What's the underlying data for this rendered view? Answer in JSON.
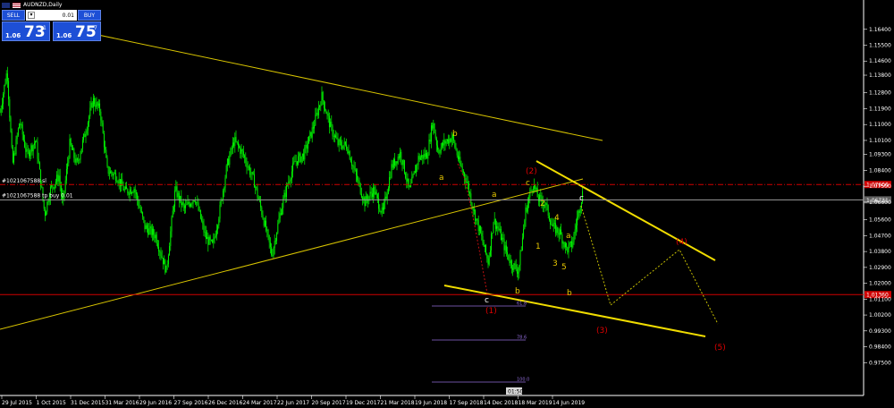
{
  "window": {
    "title": "AUDNZD,Daily"
  },
  "trade_panel": {
    "sell_label": "SELL",
    "buy_label": "BUY",
    "lot": "0.01",
    "sell_quote": {
      "small": "1.06",
      "big": "73",
      "sup": "1"
    },
    "buy_quote": {
      "small": "1.06",
      "big": "75",
      "sup": "7"
    }
  },
  "colors": {
    "background": "#000000",
    "candles": "#00ff00",
    "trendline": "#d8c400",
    "channel": "#f0dc00",
    "resistance": "#d00000",
    "support": "#d00000",
    "wave_major": "#e00000",
    "wave_minor": "#e8c800",
    "fib": "#8f6bd6"
  },
  "chart_data": {
    "type": "candlestick",
    "symbol": "AUDNZD",
    "timeframe": "Daily",
    "ylim": [
      0.965,
      1.172
    ],
    "y_ticks": [
      "1.16400",
      "1.15500",
      "1.14600",
      "1.13800",
      "1.12800",
      "1.11900",
      "1.11000",
      "1.10100",
      "1.09300",
      "1.08400",
      "1.07500",
      "1.06600",
      "1.05600",
      "1.04700",
      "1.03800",
      "1.02900",
      "1.02000",
      "1.01100",
      "1.00200",
      "0.99300",
      "0.98400",
      "0.97500"
    ],
    "x_ticks": [
      "29 Jul 2015",
      "1 Oct 2015",
      "31 Dec 2015",
      "31 Mar 2016",
      "29 Jun 2016",
      "27 Sep 2016",
      "26 Dec 2016",
      "24 Mar 2017",
      "22 Jun 2017",
      "20 Sep 2017",
      "19 Dec 2017",
      "21 Mar 2018",
      "19 Jun 2018",
      "17 Sep 2018",
      "14 Dec 2018",
      "18 Mar 2019",
      "14 Jun 2019"
    ],
    "price_path": [
      [
        0,
        1.117
      ],
      [
        8,
        1.141
      ],
      [
        14,
        1.087
      ],
      [
        22,
        1.112
      ],
      [
        30,
        1.093
      ],
      [
        40,
        1.101
      ],
      [
        50,
        1.059
      ],
      [
        56,
        1.073
      ],
      [
        66,
        1.081
      ],
      [
        70,
        1.064
      ],
      [
        78,
        1.099
      ],
      [
        86,
        1.087
      ],
      [
        96,
        1.107
      ],
      [
        104,
        1.124
      ],
      [
        112,
        1.118
      ],
      [
        120,
        1.084
      ],
      [
        130,
        1.081
      ],
      [
        140,
        1.072
      ],
      [
        150,
        1.074
      ],
      [
        162,
        1.052
      ],
      [
        174,
        1.047
      ],
      [
        186,
        1.027
      ],
      [
        196,
        1.073
      ],
      [
        206,
        1.062
      ],
      [
        218,
        1.069
      ],
      [
        230,
        1.046
      ],
      [
        238,
        1.041
      ],
      [
        246,
        1.062
      ],
      [
        254,
        1.087
      ],
      [
        262,
        1.101
      ],
      [
        272,
        1.093
      ],
      [
        284,
        1.078
      ],
      [
        294,
        1.058
      ],
      [
        304,
        1.036
      ],
      [
        314,
        1.061
      ],
      [
        322,
        1.077
      ],
      [
        330,
        1.089
      ],
      [
        340,
        1.093
      ],
      [
        350,
        1.108
      ],
      [
        360,
        1.126
      ],
      [
        370,
        1.108
      ],
      [
        378,
        1.099
      ],
      [
        388,
        1.098
      ],
      [
        398,
        1.081
      ],
      [
        408,
        1.066
      ],
      [
        418,
        1.073
      ],
      [
        428,
        1.059
      ],
      [
        438,
        1.086
      ],
      [
        448,
        1.094
      ],
      [
        458,
        1.072
      ],
      [
        468,
        1.091
      ],
      [
        478,
        1.093
      ],
      [
        484,
        1.112
      ],
      [
        490,
        1.095
      ],
      [
        498,
        1.1
      ],
      [
        506,
        1.103
      ],
      [
        514,
        1.088
      ],
      [
        522,
        1.078
      ],
      [
        530,
        1.061
      ],
      [
        538,
        1.047
      ],
      [
        546,
        1.032
      ],
      [
        552,
        1.056
      ],
      [
        558,
        1.05
      ],
      [
        566,
        1.038
      ],
      [
        572,
        1.031
      ],
      [
        580,
        1.027
      ],
      [
        588,
        1.061
      ],
      [
        596,
        1.077
      ],
      [
        602,
        1.068
      ],
      [
        610,
        1.065
      ],
      [
        618,
        1.052
      ],
      [
        626,
        1.049
      ],
      [
        634,
        1.039
      ],
      [
        640,
        1.042
      ],
      [
        646,
        1.058
      ],
      [
        652,
        1.072
      ]
    ],
    "current_price": "1.0673",
    "horizontal_levels": [
      {
        "name": "resistance-line",
        "price": 1.076,
        "style": "dash-dot",
        "label": "1.07600"
      },
      {
        "name": "price-line",
        "price": 1.0673,
        "style": "solid",
        "label": "1.06731"
      },
      {
        "name": "support-line",
        "price": 1.0136,
        "style": "solid",
        "label": "1.01360"
      }
    ],
    "object_labels": [
      "#1021067588 sl",
      "#1021067588 tp",
      "buy 0.01"
    ],
    "wave_labels": [
      "(1)",
      "(2)",
      "(3)",
      "(4)",
      "(5)",
      "a",
      "b",
      "c",
      "1",
      "2",
      "3",
      "4",
      "5"
    ],
    "fib_levels": [
      "61.8",
      "78.6",
      "100.0"
    ],
    "time_label": "01:50"
  }
}
